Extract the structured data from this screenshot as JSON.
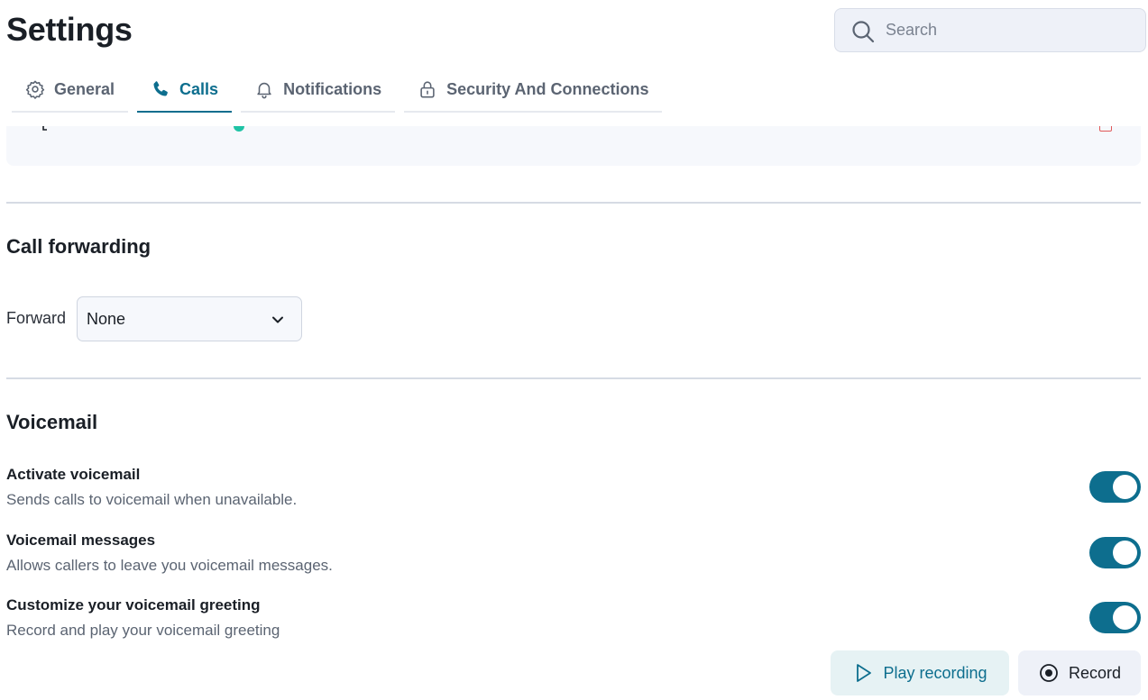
{
  "page": {
    "title": "Settings"
  },
  "search": {
    "placeholder": "Search",
    "value": ""
  },
  "tabs": [
    {
      "label": "General",
      "icon": "gear-icon",
      "active": false
    },
    {
      "label": "Calls",
      "icon": "phone-icon",
      "active": true
    },
    {
      "label": "Notifications",
      "icon": "bell-icon",
      "active": false
    },
    {
      "label": "Security And Connections",
      "icon": "lock-icon",
      "active": false
    }
  ],
  "call_forwarding": {
    "title": "Call forwarding",
    "forward_label": "Forward",
    "forward_value": "None"
  },
  "voicemail": {
    "title": "Voicemail",
    "settings": [
      {
        "title": "Activate voicemail",
        "description": "Sends calls to voicemail when unavailable.",
        "enabled": true
      },
      {
        "title": "Voicemail messages",
        "description": "Allows callers to leave you voicemail messages.",
        "enabled": true
      },
      {
        "title": "Customize your voicemail greeting",
        "description": "Record and play your voicemail greeting",
        "enabled": true
      }
    ],
    "play_label": "Play recording",
    "record_label": "Record"
  },
  "colors": {
    "accent": "#0d6e8e",
    "toggle_on": "#0d6e8e",
    "status_dot": "#1fc3a5",
    "danger": "#e05959"
  }
}
